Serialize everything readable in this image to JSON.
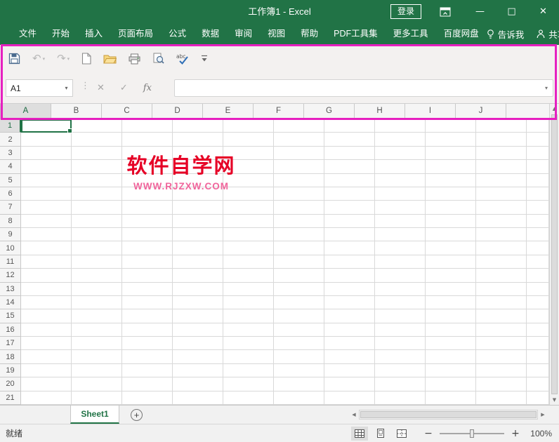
{
  "annotation": {
    "highlight_color": "#e620c0"
  },
  "titlebar": {
    "title": "工作簿1 - Excel",
    "login": "登录",
    "minimize": "—",
    "maximize": "□",
    "close": "✕"
  },
  "menubar": {
    "tabs": [
      "文件",
      "开始",
      "插入",
      "页面布局",
      "公式",
      "数据",
      "审阅",
      "视图",
      "帮助",
      "PDF工具集",
      "更多工具",
      "百度网盘"
    ],
    "tell_me": "告诉我",
    "share": "共享"
  },
  "toolbar": {
    "icons": [
      "save-icon",
      "undo-icon",
      "redo-icon",
      "new-file-icon",
      "open-folder-icon",
      "print-icon",
      "print-preview-icon",
      "spell-check-icon",
      "customize-toolbar-icon"
    ],
    "undo_glyph": "↶",
    "redo_glyph": "↷"
  },
  "formula_bar": {
    "name_box_value": "A1",
    "name_box_arrow": "▾",
    "cancel_glyph": "✕",
    "enter_glyph": "✓",
    "fx_label": "fx",
    "dropdown_arrow": "▾"
  },
  "grid": {
    "selected_cell": "A1",
    "columns": [
      "A",
      "B",
      "C",
      "D",
      "E",
      "F",
      "G",
      "H",
      "I",
      "J"
    ],
    "rows": [
      1,
      2,
      3,
      4,
      5,
      6,
      7,
      8,
      9,
      10,
      11,
      12,
      13,
      14,
      15,
      16,
      17,
      18,
      19,
      20,
      21
    ]
  },
  "watermark": {
    "title": "软件自学网",
    "url": "WWW.RJZXW.COM",
    "title_color": "#e60026",
    "url_color": "#f0649b"
  },
  "scrollbars": {
    "up": "▲",
    "down": "▼",
    "left": "◀",
    "right": "▶"
  },
  "sheet_tabs": {
    "active": "Sheet1",
    "add_label": "+"
  },
  "statusbar": {
    "ready": "就绪",
    "zoom_out": "−",
    "zoom_in": "+",
    "zoom_level": "100%"
  }
}
